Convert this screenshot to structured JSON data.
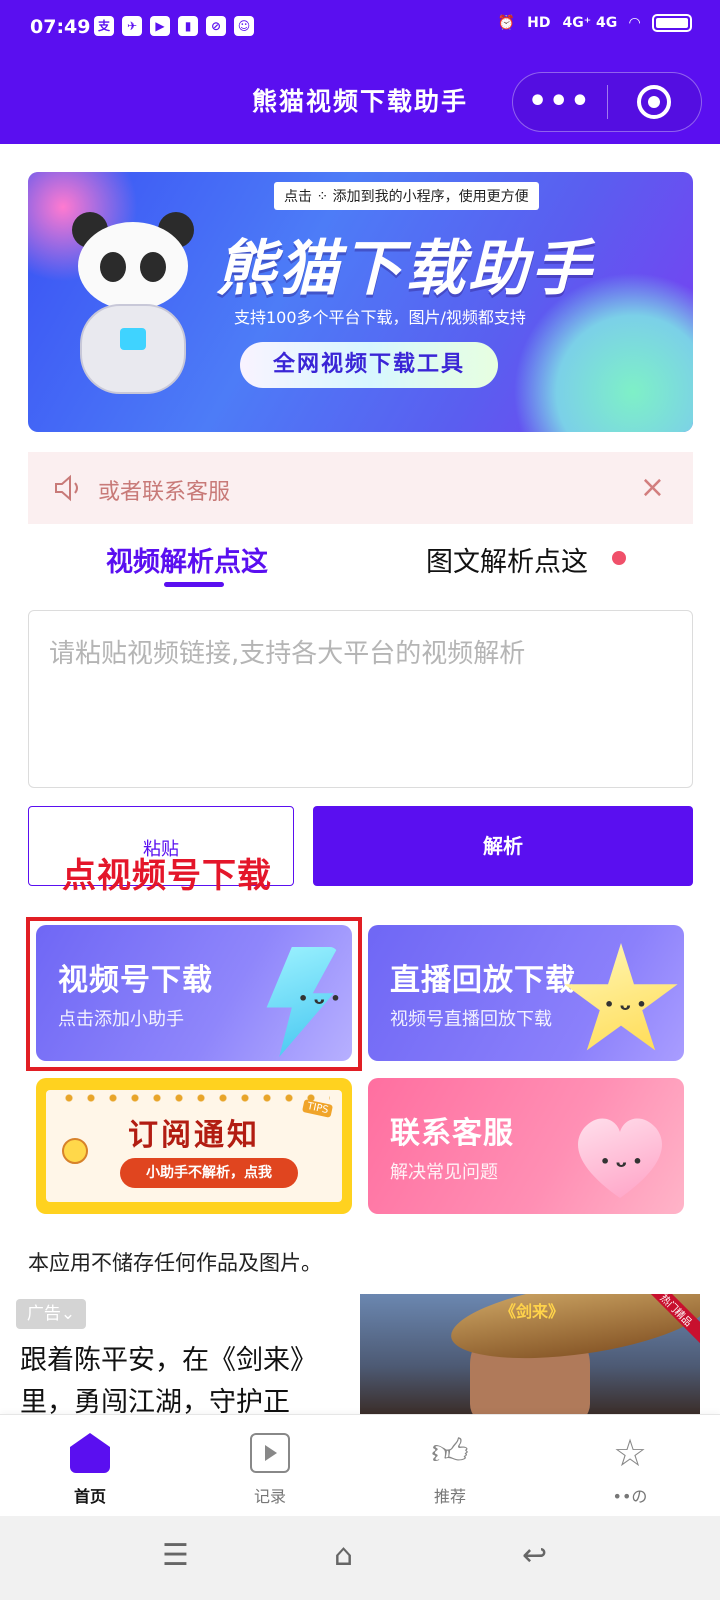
{
  "status_bar": {
    "time": "07:49",
    "network": "4G⁺ 4G",
    "app_icons": [
      "支",
      "✈",
      "▶",
      "▮",
      "⊘",
      "☺"
    ]
  },
  "header": {
    "title": "熊猫视频下载助手",
    "more_icon": "more-dots-icon",
    "target_icon": "target-icon"
  },
  "banner": {
    "chip": "点击 ⁘ 添加到我的小程序，使用更方便",
    "title": "熊猫下载助手",
    "subtitle": "支持100多个平台下载，图片/视频都支持",
    "pill": "全网视频下载工具"
  },
  "notice": {
    "text": "或者联系客服",
    "close": "×"
  },
  "tabs": {
    "video": "视频解析点这",
    "image": "图文解析点这"
  },
  "input": {
    "placeholder": "请粘贴视频链接,支持各大平台的视频解析"
  },
  "buttons": {
    "paste": "粘贴",
    "parse": "解析",
    "overlay": "点视频号下载"
  },
  "cards": {
    "video_title": "视频号下载",
    "video_sub": "点击添加小助手",
    "live_title": "直播回放下载",
    "live_sub": "视频号直播回放下载",
    "subscribe_title": "订阅通知",
    "subscribe_sub": "小助手不解析，点我",
    "subscribe_tips": "TIPS",
    "contact_title": "联系客服",
    "contact_sub": "解决常见问题"
  },
  "disclaimer": "本应用不储存任何作品及图片。",
  "ad": {
    "badge": "广告⌄",
    "text": "跟着陈平安，在《剑来》里，勇闯江湖，守护正",
    "image_title": "《剑来》",
    "corner": "热门精品"
  },
  "tabbar": {
    "home": "首页",
    "records": "记录",
    "recommend": "推荐",
    "more": "••の"
  },
  "colors": {
    "primary": "#5a0ff0",
    "highlight": "#e11e24",
    "notice_bg": "#fbeff0",
    "red_dot": "#f0506a"
  }
}
